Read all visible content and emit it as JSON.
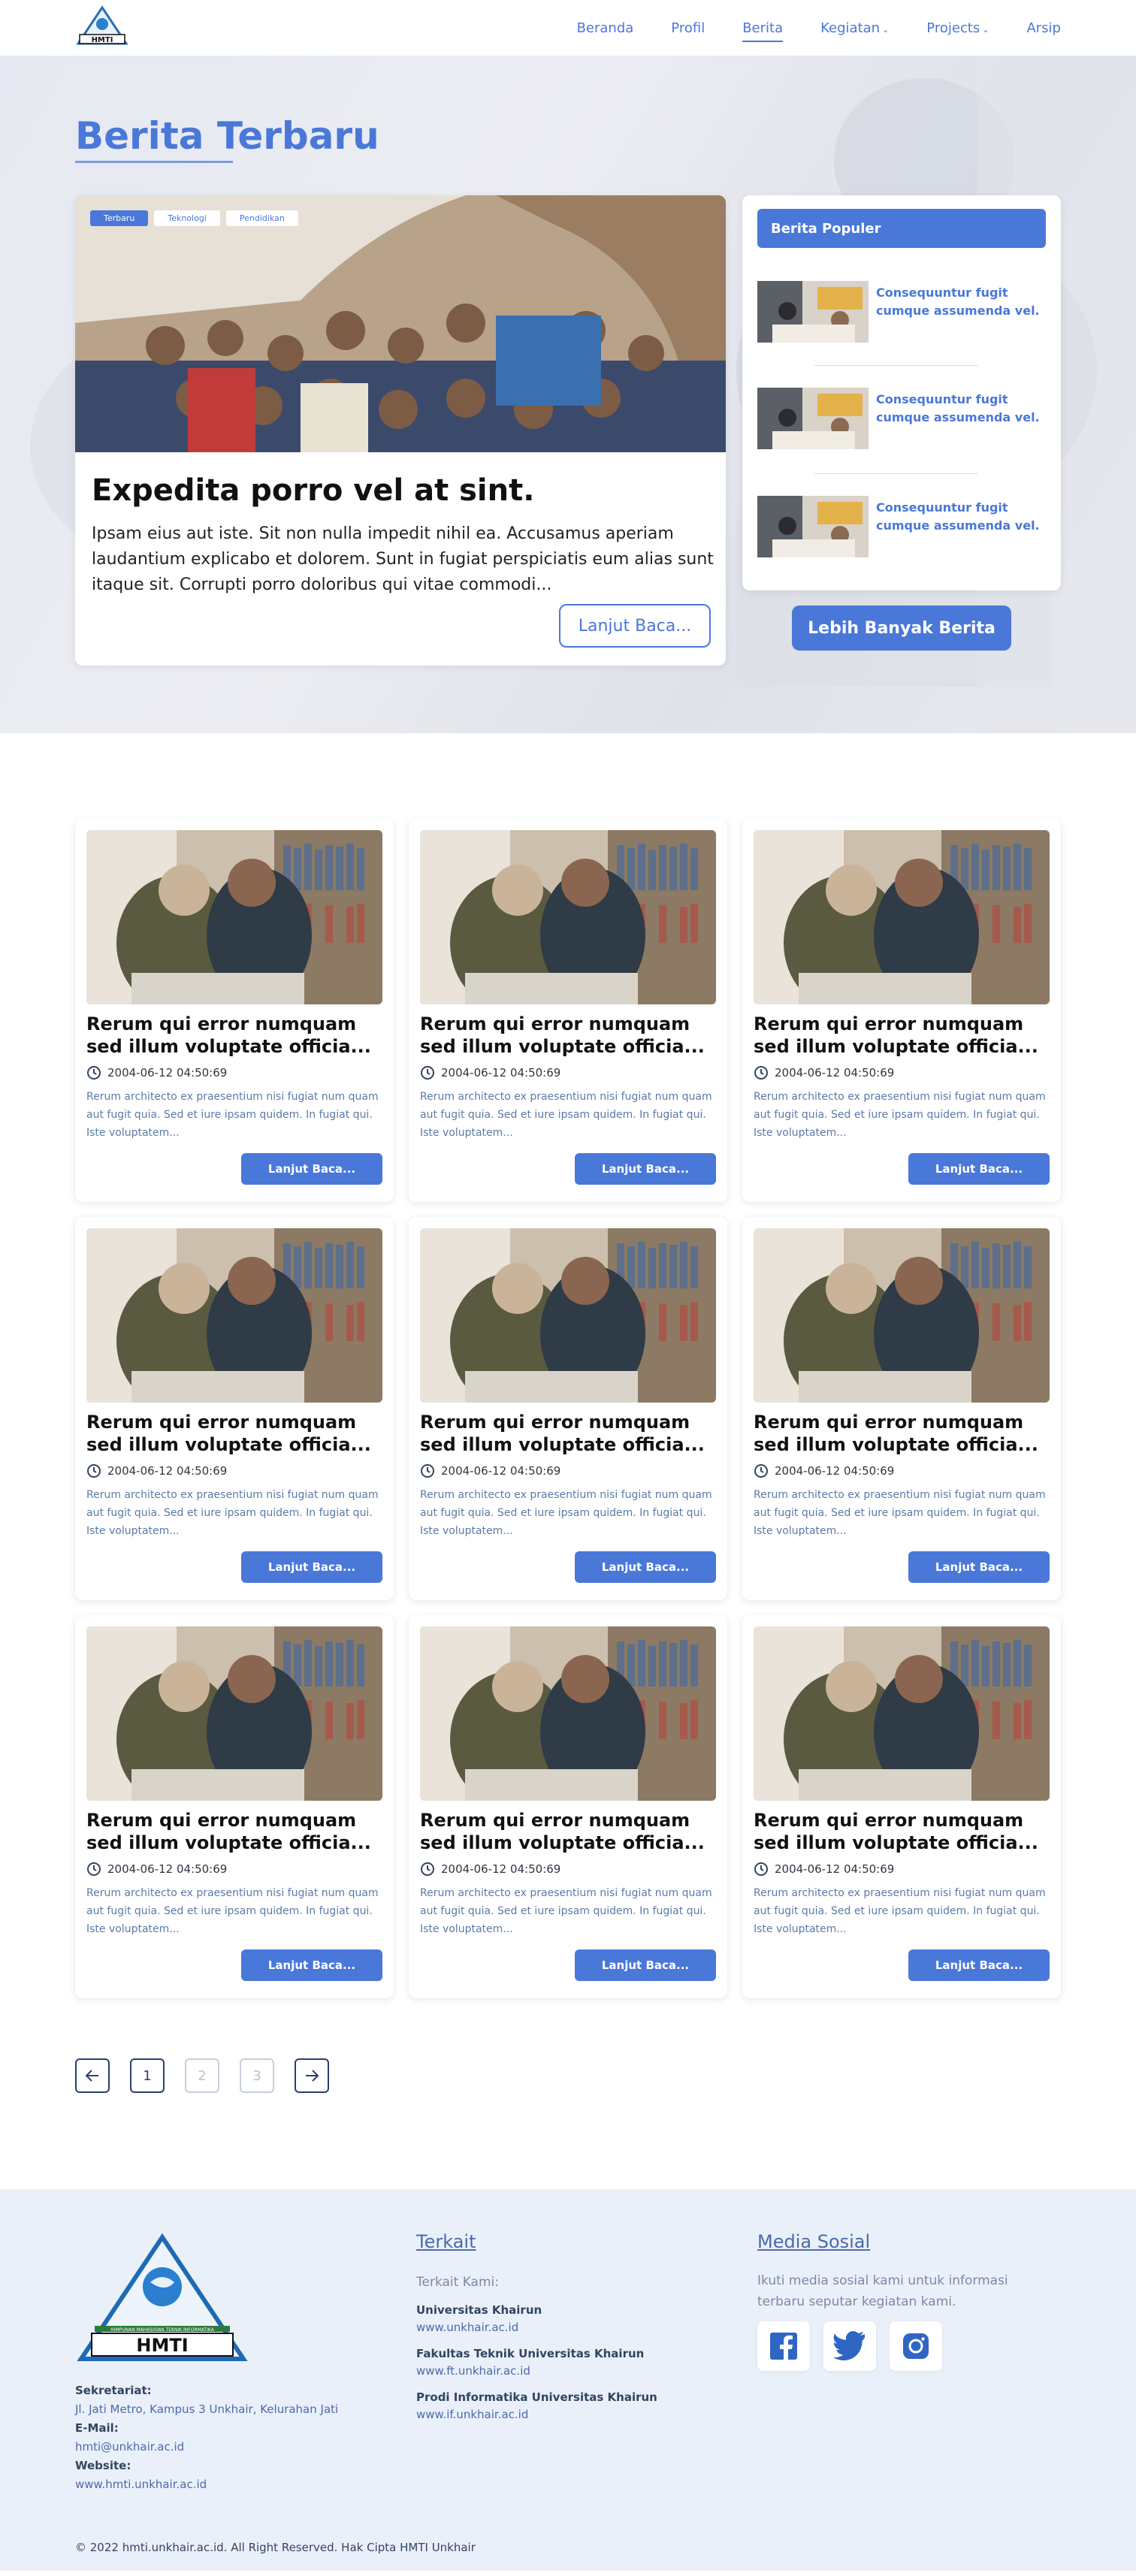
{
  "nav": {
    "logo_text": "HMTI",
    "links": [
      {
        "label": "Beranda"
      },
      {
        "label": "Profil"
      },
      {
        "label": "Berita",
        "active": true
      },
      {
        "label": "Kegiatan",
        "dropdown": true
      },
      {
        "label": "Projects",
        "dropdown": true
      },
      {
        "label": "Arsip"
      }
    ],
    "accent_color": "#4a78d8"
  },
  "hero": {
    "title": "Berita Terbaru",
    "tags": [
      "Terbaru",
      "Teknologi",
      "Pendidikan"
    ],
    "feature": {
      "title": "Expedita porro vel at sint.",
      "text": "Ipsam eius aut iste. Sit non nulla impedit nihil ea. Accusamus aperiam laudantium explicabo et dolorem. Sunt in fugiat perspiciatis eum alias sunt itaque sit. Corrupti porro doloribus qui vitae commodi...",
      "button": "Lanjut Baca..."
    },
    "popular": {
      "heading": "Berita Populer",
      "items": [
        {
          "title": "Consequuntur fugit cumque assumenda vel."
        },
        {
          "title": "Consequuntur fugit cumque assumenda vel."
        },
        {
          "title": "Consequuntur fugit cumque assumenda vel."
        }
      ]
    },
    "more_button": "Lebih Banyak Berita"
  },
  "cards": [
    {
      "title": "Rerum qui error numquam sed illum voluptate officia...",
      "date": "2004-06-12 04:50:69",
      "excerpt": "Rerum architecto ex praesentium nisi fugiat num quam aut fugit quia. Sed et iure ipsam quidem. In fugiat qui. Iste voluptatem...",
      "button": "Lanjut Baca..."
    },
    {
      "title": "Rerum qui error numquam sed illum voluptate officia...",
      "date": "2004-06-12 04:50:69",
      "excerpt": "Rerum architecto ex praesentium nisi fugiat num quam aut fugit quia. Sed et iure ipsam quidem. In fugiat qui. Iste voluptatem...",
      "button": "Lanjut Baca..."
    },
    {
      "title": "Rerum qui error numquam sed illum voluptate officia...",
      "date": "2004-06-12 04:50:69",
      "excerpt": "Rerum architecto ex praesentium nisi fugiat num quam aut fugit quia. Sed et iure ipsam quidem. In fugiat qui. Iste voluptatem...",
      "button": "Lanjut Baca..."
    },
    {
      "title": "Rerum qui error numquam sed illum voluptate officia...",
      "date": "2004-06-12 04:50:69",
      "excerpt": "Rerum architecto ex praesentium nisi fugiat num quam aut fugit quia. Sed et iure ipsam quidem. In fugiat qui. Iste voluptatem...",
      "button": "Lanjut Baca..."
    },
    {
      "title": "Rerum qui error numquam sed illum voluptate officia...",
      "date": "2004-06-12 04:50:69",
      "excerpt": "Rerum architecto ex praesentium nisi fugiat num quam aut fugit quia. Sed et iure ipsam quidem. In fugiat qui. Iste voluptatem...",
      "button": "Lanjut Baca..."
    },
    {
      "title": "Rerum qui error numquam sed illum voluptate officia...",
      "date": "2004-06-12 04:50:69",
      "excerpt": "Rerum architecto ex praesentium nisi fugiat num quam aut fugit quia. Sed et iure ipsam quidem. In fugiat qui. Iste voluptatem...",
      "button": "Lanjut Baca..."
    },
    {
      "title": "Rerum qui error numquam sed illum voluptate officia...",
      "date": "2004-06-12 04:50:69",
      "excerpt": "Rerum architecto ex praesentium nisi fugiat num quam aut fugit quia. Sed et iure ipsam quidem. In fugiat qui. Iste voluptatem...",
      "button": "Lanjut Baca..."
    },
    {
      "title": "Rerum qui error numquam sed illum voluptate officia...",
      "date": "2004-06-12 04:50:69",
      "excerpt": "Rerum architecto ex praesentium nisi fugiat num quam aut fugit quia. Sed et iure ipsam quidem. In fugiat qui. Iste voluptatem...",
      "button": "Lanjut Baca..."
    },
    {
      "title": "Rerum qui error numquam sed illum voluptate officia...",
      "date": "2004-06-12 04:50:69",
      "excerpt": "Rerum architecto ex praesentium nisi fugiat num quam aut fugit quia. Sed et iure ipsam quidem. In fugiat qui. Iste voluptatem...",
      "button": "Lanjut Baca..."
    }
  ],
  "pagination": {
    "prev_icon": "arrow-left-icon",
    "next_icon": "arrow-right-icon",
    "pages": [
      "1",
      "2",
      "3"
    ],
    "current": "1"
  },
  "footer": {
    "logo_caption": "HMTI",
    "logo_banner": "HIMPUNAN MAHASISWA TEKNIK INFORMATIKA",
    "secretariat_label": "Sekretariat:",
    "secretariat_value": "Jl. Jati Metro, Kampus 3 Unkhair, Kelurahan Jati",
    "email_label": "E-Mail:",
    "email_value": "hmti@unkhair.ac.id",
    "website_label": "Website:",
    "website_value": "www.hmti.unkhair.ac.id",
    "related": {
      "heading": "Terkait",
      "sub": "Terkait Kami:",
      "links": [
        {
          "title": "Universitas Khairun",
          "url": "www.unkhair.ac.id"
        },
        {
          "title": "Fakultas Teknik Universitas Khairun",
          "url": "www.ft.unkhair.ac.id"
        },
        {
          "title": "Prodi Informatika Universitas Khairun",
          "url": "www.if.unkhair.ac.id"
        }
      ]
    },
    "social": {
      "heading": "Media Sosial",
      "text": "Ikuti media sosial kami untuk informasi terbaru seputar kegiatan kami.",
      "icons": [
        "facebook-icon",
        "twitter-icon",
        "instagram-icon"
      ]
    },
    "copyright": "© 2022 hmti.unkhair.ac.id. All Right Reserved. Hak Cipta HMTI Unkhair"
  }
}
